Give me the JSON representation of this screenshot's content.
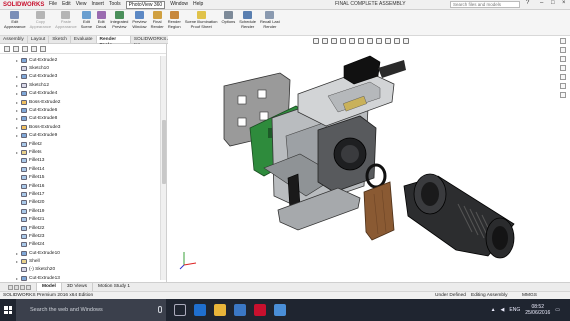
{
  "app": {
    "logo": "SOLIDWORKS",
    "window_title": "FINAL COMPLETE ASSEMBLY",
    "search_placeholder": "Search files and models",
    "menu": [
      "File",
      "Edit",
      "View",
      "Insert",
      "Tools",
      "PhotoView 360",
      "Window",
      "Help"
    ],
    "highlighted_menu": "PhotoView 360"
  },
  "ribbon": [
    {
      "label": "Edit\nAppearance",
      "icon": "appearance-icon",
      "color": "#7b8fb8",
      "disabled": false
    },
    {
      "label": "Copy\nAppearance",
      "icon": "copy-icon",
      "color": "#b5b5b5",
      "disabled": true
    },
    {
      "label": "Paste\nAppearance",
      "icon": "paste-icon",
      "color": "#b5b5b5",
      "disabled": true
    },
    {
      "label": "Edit\nScene",
      "icon": "scene-icon",
      "color": "#6a9fd0",
      "disabled": false
    },
    {
      "label": "Edit\nDecal",
      "icon": "decal-icon",
      "color": "#9a6bb0",
      "disabled": false
    },
    {
      "label": "Integrated\nPreview",
      "icon": "preview-icon",
      "color": "#4a8f5a",
      "disabled": false
    },
    {
      "label": "Preview\nWindow",
      "icon": "window-icon",
      "color": "#5c88c4",
      "disabled": false
    },
    {
      "label": "Final\nRender",
      "icon": "render-icon",
      "color": "#d0a040",
      "disabled": false
    },
    {
      "label": "Render\nRegion",
      "icon": "region-icon",
      "color": "#c7873c",
      "disabled": false
    },
    {
      "label": "Scene Illumination\nProof Sheet",
      "icon": "illumination-icon",
      "color": "#e0c24a",
      "disabled": false
    },
    {
      "label": "Options",
      "icon": "options-icon",
      "color": "#7d8a99",
      "disabled": false
    },
    {
      "label": "Schedule\nRender",
      "icon": "schedule-icon",
      "color": "#5a7fb0",
      "disabled": false
    },
    {
      "label": "Recall Last\nRender",
      "icon": "recall-icon",
      "color": "#8a9ab0",
      "disabled": false
    }
  ],
  "command_tabs": [
    {
      "label": "Assembly",
      "active": false
    },
    {
      "label": "Layout",
      "active": false
    },
    {
      "label": "Sketch",
      "active": false
    },
    {
      "label": "Evaluate",
      "active": false
    },
    {
      "label": "Render Tools",
      "active": true
    },
    {
      "label": "SOLIDWORKS Add-Ins",
      "active": false
    },
    {
      "label": "SOLIDWORKS MBD",
      "active": false
    }
  ],
  "tree": [
    {
      "label": "Cut-Extrude2",
      "type": "cut",
      "indent": 0,
      "expand": true
    },
    {
      "label": "Sketch10",
      "type": "sketch",
      "indent": 0,
      "expand": false
    },
    {
      "label": "Cut-Extrude3",
      "type": "cut",
      "indent": 0,
      "expand": true
    },
    {
      "label": "Sketch12",
      "type": "sketch",
      "indent": 0,
      "expand": true
    },
    {
      "label": "Cut-Extrude4",
      "type": "cut",
      "indent": 0,
      "expand": true
    },
    {
      "label": "Boss-Extrude2",
      "type": "boss",
      "indent": 0,
      "expand": true
    },
    {
      "label": "Cut-Extrude6",
      "type": "cut",
      "indent": 0,
      "expand": true
    },
    {
      "label": "Cut-Extrude8",
      "type": "cut",
      "indent": 0,
      "expand": true
    },
    {
      "label": "Boss-Extrude3",
      "type": "boss",
      "indent": 0,
      "expand": true
    },
    {
      "label": "Cut-Extrude9",
      "type": "cut",
      "indent": 0,
      "expand": true
    },
    {
      "label": "Fillet2",
      "type": "fillet",
      "indent": 0,
      "expand": false
    },
    {
      "label": "Fillets",
      "type": "folder",
      "indent": 0,
      "expand": true
    },
    {
      "label": "Fillet13",
      "type": "fillet",
      "indent": 1,
      "expand": false
    },
    {
      "label": "Fillet14",
      "type": "fillet",
      "indent": 1,
      "expand": false
    },
    {
      "label": "Fillet15",
      "type": "fillet",
      "indent": 1,
      "expand": false
    },
    {
      "label": "Fillet16",
      "type": "fillet",
      "indent": 1,
      "expand": false
    },
    {
      "label": "Fillet17",
      "type": "fillet",
      "indent": 1,
      "expand": false
    },
    {
      "label": "Fillet20",
      "type": "fillet",
      "indent": 1,
      "expand": false
    },
    {
      "label": "Fillet19",
      "type": "fillet",
      "indent": 1,
      "expand": false
    },
    {
      "label": "Fillet21",
      "type": "fillet",
      "indent": 1,
      "expand": false
    },
    {
      "label": "Fillet22",
      "type": "fillet",
      "indent": 1,
      "expand": false
    },
    {
      "label": "Fillet23",
      "type": "fillet",
      "indent": 1,
      "expand": false
    },
    {
      "label": "Fillet24",
      "type": "fillet",
      "indent": 1,
      "expand": false
    },
    {
      "label": "Cut-Extrude10",
      "type": "cut",
      "indent": 0,
      "expand": true
    },
    {
      "label": "Shell",
      "type": "folder",
      "indent": 0,
      "expand": true
    },
    {
      "label": "(-) Sketch20",
      "type": "sketch",
      "indent": 1,
      "expand": false
    },
    {
      "label": "Cut-Extrude13",
      "type": "cut",
      "indent": 0,
      "expand": true
    }
  ],
  "bottom_tabs": [
    {
      "label": "Model",
      "active": true
    },
    {
      "label": "3D Views",
      "active": false
    },
    {
      "label": "Motion Study 1",
      "active": false
    }
  ],
  "status": {
    "left": "SOLIDWORKS Premium 2016 x64 Edition",
    "defined": "Under Defined",
    "editing": "Editing Assembly",
    "units": "MMGS"
  },
  "taskbar": {
    "search_placeholder": "Search the web and Windows",
    "language": "ENG",
    "time": "08:52",
    "date": "25/06/2016"
  },
  "colors": {
    "accent": "#c8102e",
    "taskbar": "#1f2530"
  }
}
